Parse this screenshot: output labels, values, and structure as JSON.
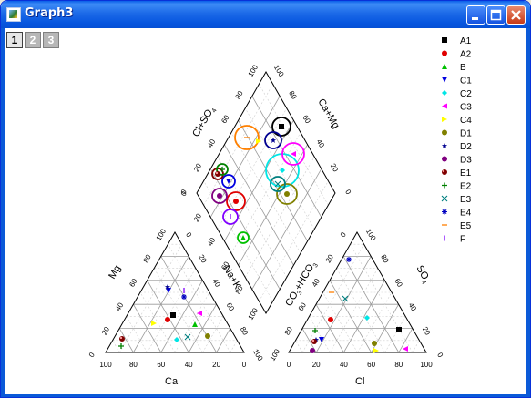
{
  "window": {
    "title": "Graph3"
  },
  "layers": [
    {
      "label": "1",
      "active": true
    },
    {
      "label": "2",
      "active": false
    },
    {
      "label": "3",
      "active": false
    }
  ],
  "chart": {
    "type": "piper",
    "axis_labels": {
      "mg": "Mg",
      "ca": "Ca",
      "na_k": "Na+K",
      "cl": "Cl",
      "so4": "SO",
      "so4_sub": "4",
      "co3_hco3": "CO",
      "co3_sub": "3",
      "co3_rest": "+HCO",
      "hco3_sub": "3",
      "cl_so4": "Cl+SO",
      "cl_so4_sub": "4",
      "ca_mg": "Ca+Mg"
    },
    "ticks": [
      "0",
      "20",
      "40",
      "60",
      "80",
      "100"
    ]
  },
  "legend": [
    {
      "label": "A1",
      "symbol": "square",
      "color": "#000000"
    },
    {
      "label": "A2",
      "symbol": "circle",
      "color": "#e00000"
    },
    {
      "label": "B",
      "symbol": "tri-up",
      "color": "#00c000"
    },
    {
      "label": "C1",
      "symbol": "tri-down",
      "color": "#0000e0"
    },
    {
      "label": "C2",
      "symbol": "diamond",
      "color": "#00e6e6"
    },
    {
      "label": "C3",
      "symbol": "tri-left",
      "color": "#ff00ff"
    },
    {
      "label": "C4",
      "symbol": "tri-right",
      "color": "#ffff00"
    },
    {
      "label": "D1",
      "symbol": "hexagon",
      "color": "#808000"
    },
    {
      "label": "D2",
      "symbol": "star",
      "color": "#000090"
    },
    {
      "label": "D3",
      "symbol": "circle",
      "color": "#800080"
    },
    {
      "label": "E1",
      "symbol": "sphere",
      "color": "#800000"
    },
    {
      "label": "E2",
      "symbol": "plus",
      "color": "#008000"
    },
    {
      "label": "E3",
      "symbol": "cross",
      "color": "#008080"
    },
    {
      "label": "E4",
      "symbol": "asterisk",
      "color": "#0000c0"
    },
    {
      "label": "E5",
      "symbol": "hbar",
      "color": "#ff8000"
    },
    {
      "label": "F",
      "symbol": "vbar",
      "color": "#8000ff"
    }
  ]
}
